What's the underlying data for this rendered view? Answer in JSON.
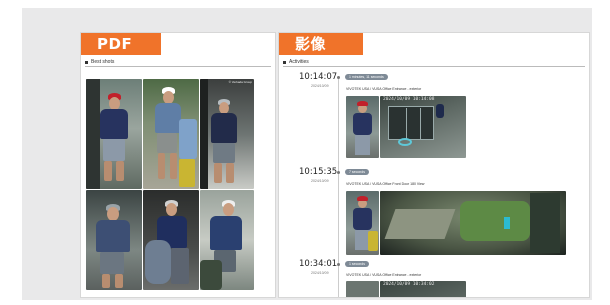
{
  "pdf_card": {
    "tag": "PDF",
    "section_label": "Best shots",
    "photo_watermark": "© Verkada Group"
  },
  "video_card": {
    "tag": "影像",
    "section_label": "Activities",
    "activities": [
      {
        "time": "10:14:07",
        "date": "2024/10/09",
        "duration": "1 minutes, 11 seconds",
        "camera": "VIVOTEK USA  /  VUSA Office Entrance - exterior",
        "cctv_timestamp": "2024/10/09 10:14:08"
      },
      {
        "time": "10:15:35",
        "date": "2024/10/09",
        "duration": "7 seconds",
        "camera": "VIVOTEK USA  /  VUSA Office Front Door 180 View",
        "cctv_timestamp": ""
      },
      {
        "time": "10:34:01",
        "date": "2024/10/09",
        "duration": "1 seconds",
        "camera": "VIVOTEK USA  /  VUSA Office Entrance - exterior",
        "cctv_timestamp": "2024/10/09 10:34:02"
      }
    ]
  },
  "colors": {
    "tag_orange": "#f0732a",
    "stage_grey": "#e9e9ea",
    "pill_grey": "#7e8a96"
  }
}
